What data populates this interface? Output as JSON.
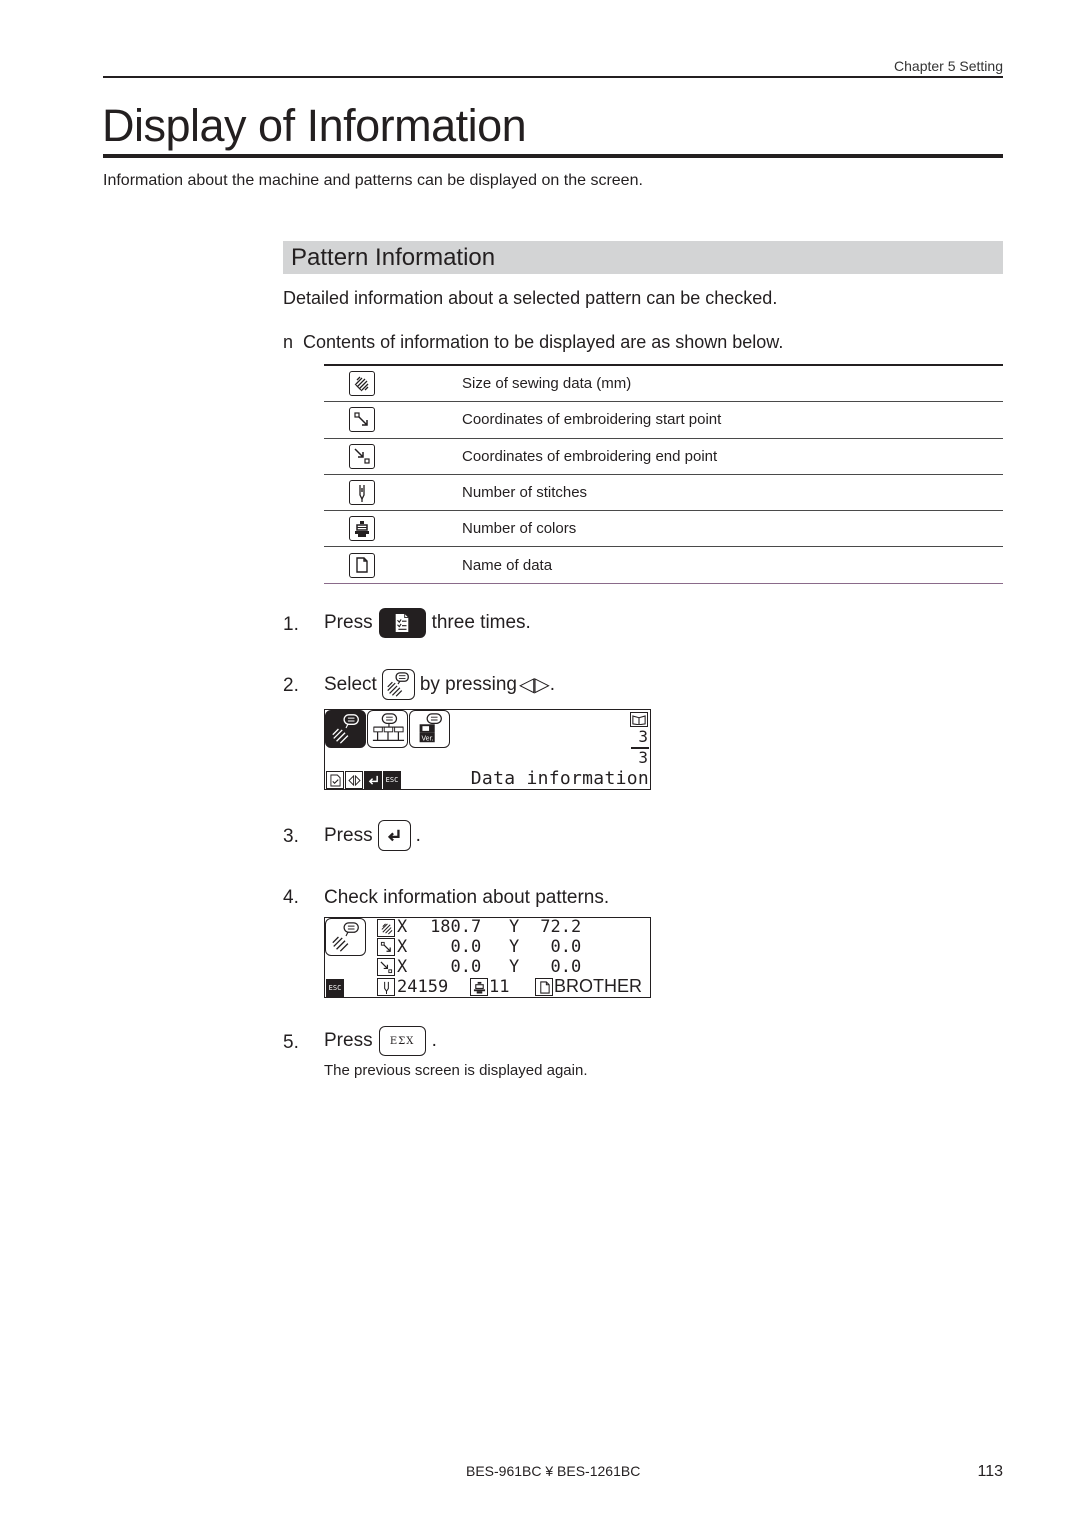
{
  "header": {
    "chapter": "Chapter 5 Setting",
    "title": "Display of Information",
    "intro": "Information about the machine and patterns can be displayed on the screen."
  },
  "section": {
    "title": "Pattern Information",
    "description": "Detailed information about a selected pattern can be checked.",
    "bullet_marker": "n",
    "bullet_text": "Contents of information to be displayed are as shown below."
  },
  "info_table": [
    {
      "icon": "sewing-size-icon",
      "label": "Size of sewing data (mm)"
    },
    {
      "icon": "start-point-icon",
      "label": "Coordinates of embroidering start point"
    },
    {
      "icon": "end-point-icon",
      "label": "Coordinates of embroidering end point"
    },
    {
      "icon": "needle-stitches-icon",
      "label": "Number of stitches"
    },
    {
      "icon": "color-spool-icon",
      "label": "Number of colors"
    },
    {
      "icon": "document-icon",
      "label": "Name of data"
    }
  ],
  "steps": [
    {
      "num": "1.",
      "before": "Press",
      "button": "menu-button",
      "after": "three times."
    },
    {
      "num": "2.",
      "before": "Select",
      "button": "data-info-icon",
      "after": "by pressing",
      "arrows": "◁▷",
      "end": "."
    },
    {
      "num": "3.",
      "before": "Press",
      "button": "enter-button",
      "after": "."
    },
    {
      "num": "4.",
      "text": "Check information about patterns."
    },
    {
      "num": "5.",
      "before": "Press",
      "button_label": "ΕΣΧ",
      "after": ".",
      "note": "The previous screen is displayed again."
    }
  ],
  "lcd1": {
    "page_current": "3",
    "page_total": "3",
    "caption": "Data information",
    "footer_keys": [
      "check",
      "◁▷",
      "↵",
      "ESC"
    ],
    "top_right_icon": "book-icon",
    "ver_label": "Ver."
  },
  "lcd2": {
    "size": {
      "x_label": "X",
      "x": "180.7",
      "y_label": "Y",
      "y": "72.2"
    },
    "start": {
      "x_label": "X",
      "x": "0.0",
      "y_label": "Y",
      "y": "0.0"
    },
    "end": {
      "x_label": "X",
      "x": "0.0",
      "y_label": "Y",
      "y": "0.0"
    },
    "stitches": "24159",
    "colors": "11",
    "name": "BROTHER",
    "esc_label": "ESC"
  },
  "footer": {
    "model": "BES-961BC ¥ BES-1261BC",
    "page": "113"
  }
}
